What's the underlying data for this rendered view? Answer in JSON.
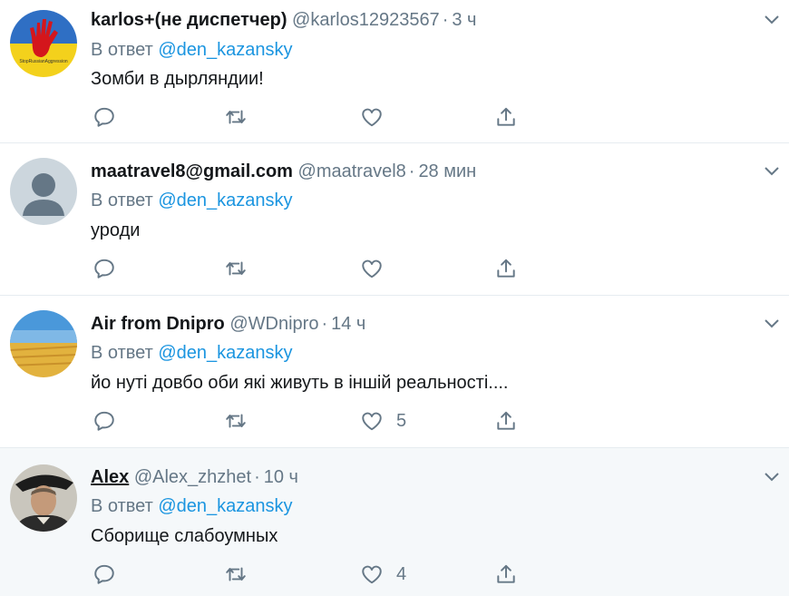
{
  "tweets": [
    {
      "name": "karlos+(не диспетчер)",
      "handle": "@karlos12923567",
      "separator": "·",
      "time": "3 ч",
      "reply_prefix": "В ответ",
      "mention": "@den_kazansky",
      "text": "Зомби в дырляндии!",
      "likes": "",
      "avatar_caption": "StopRussianAggression"
    },
    {
      "name": "maatravel8@gmail.com",
      "handle": "@maatravel8",
      "separator": "·",
      "time": "28 мин",
      "reply_prefix": "В ответ",
      "mention": "@den_kazansky",
      "text": "уроди",
      "likes": ""
    },
    {
      "name": "Air from Dnipro",
      "handle": "@WDnipro",
      "separator": "·",
      "time": "14 ч",
      "reply_prefix": "В ответ",
      "mention": "@den_kazansky",
      "text": "йо  нуті довбо  оби які живуть в іншій реальності....",
      "likes": "5"
    },
    {
      "name": "Alex",
      "handle": "@Alex_zhzhet",
      "separator": "·",
      "time": "10 ч",
      "reply_prefix": "В ответ",
      "mention": "@den_kazansky",
      "text": "Сборище слабоумных",
      "likes": "4"
    }
  ],
  "icons": {
    "reply": "reply-icon",
    "retweet": "retweet-icon",
    "like": "heart-icon",
    "share": "share-icon",
    "menu": "chevron-down-icon"
  },
  "colors": {
    "text": "#14171a",
    "secondary": "#657786",
    "mention": "#1b95e0",
    "divider": "#e6ecf0",
    "highlight_bg": "#f5f8fa"
  }
}
